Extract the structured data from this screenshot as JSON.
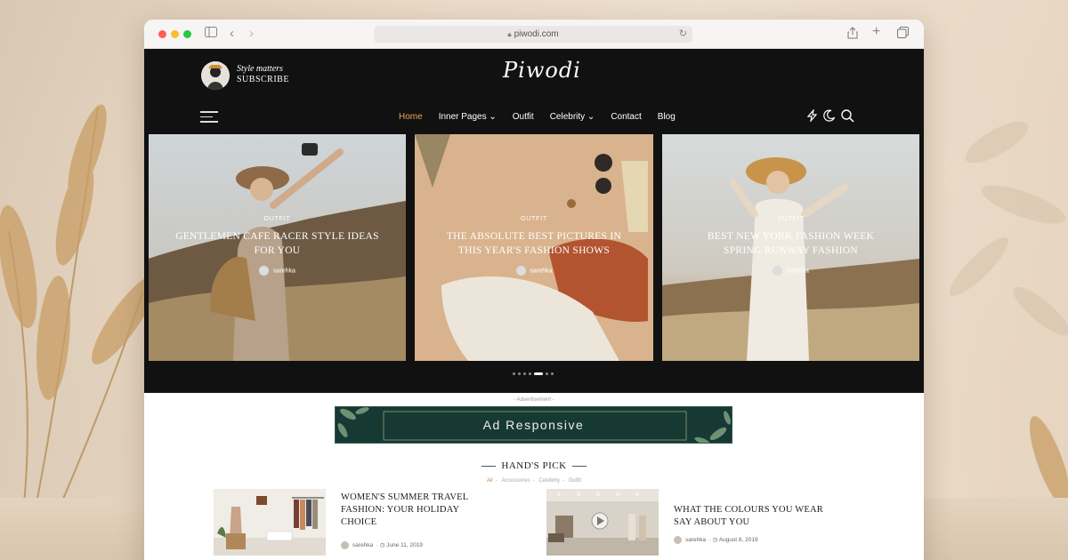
{
  "browser": {
    "url": "piwodi.com"
  },
  "site": {
    "subscribe_tagline": "Style matters",
    "subscribe_label": "SUBSCRIBE",
    "logo_text": "Piwodi",
    "nav": [
      {
        "label": "Home",
        "dropdown": false,
        "active": true
      },
      {
        "label": "Inner Pages ⌄",
        "dropdown": true,
        "active": false
      },
      {
        "label": "Outfit",
        "dropdown": false,
        "active": false
      },
      {
        "label": "Celebrity ⌄",
        "dropdown": true,
        "active": false
      },
      {
        "label": "Contact",
        "dropdown": false,
        "active": false
      },
      {
        "label": "Blog",
        "dropdown": false,
        "active": false
      }
    ],
    "accent_color": "#f0a24d"
  },
  "slider": {
    "slides": [
      {
        "category": "OUTFIT",
        "title": "Gentlemen Cafe Racer Style Ideas For You",
        "author": "sarehka"
      },
      {
        "category": "OUTFIT",
        "title": "The Absolute Best Pictures In This Year's Fashion Shows",
        "author": "sarehka"
      },
      {
        "category": "OUTFIT",
        "title": "Best New York Fashion Week Spring Runway Fashion",
        "author": "sarehka"
      }
    ],
    "dot_count": 7,
    "active_dot": 4
  },
  "ad": {
    "label": "- Advertisement -",
    "text": "Ad Responsive"
  },
  "hands_pick": {
    "title": "HAND'S PICK",
    "filters": [
      "All",
      "Accessories",
      "Celebrity",
      "Outfit"
    ],
    "active_filter": 0,
    "posts": [
      {
        "title": "Women's Summer Travel Fashion: Your Holiday Choice",
        "author": "sarehka",
        "date": "June 11, 2019"
      },
      {
        "title": "What the Colours You Wear Say About You",
        "author": "sarehka",
        "date": "August 8, 2019"
      }
    ]
  }
}
